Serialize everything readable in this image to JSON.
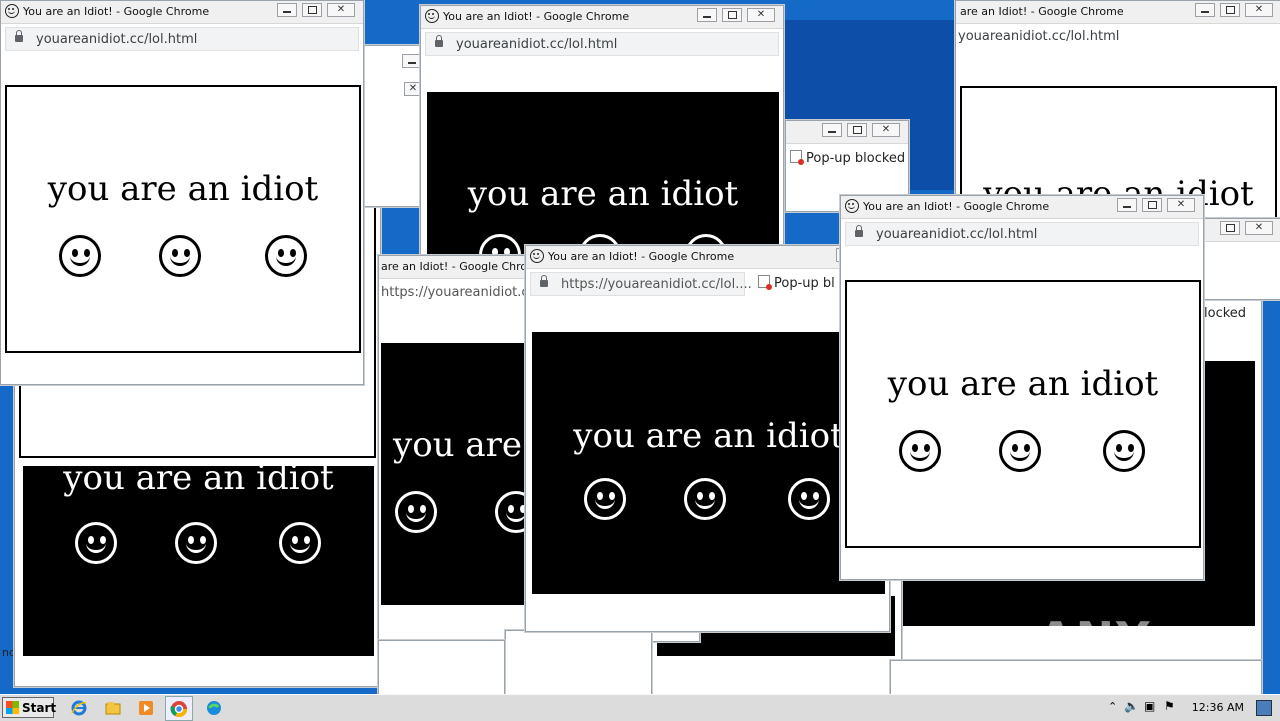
{
  "popup": {
    "title": "You are an Idiot! - Google Chrome",
    "title_partial": "are an Idiot! - Google Chrome",
    "url_short": "youareanidiot.cc/lol.html",
    "url_https": "https://youareanidiot.cc/lol.html",
    "url_https_trunc": "https://youareanidiot.cc/lol....",
    "message": "you are an idiot",
    "message_partial": "you are",
    "popup_blocked": "Pop-up blocked",
    "popup_blocked_trunc": "Pop-up bl",
    "popup_blocked_end": "locked"
  },
  "taskbar": {
    "start": "Start",
    "clock": "12:36 AM",
    "icons": [
      "ie-icon",
      "explorer-icon",
      "media-player-icon",
      "chrome-icon",
      "edge-icon"
    ]
  },
  "desktop": {
    "watermark": "ANY RUN",
    "side_fragment": "no"
  },
  "colors": {
    "desktop": "#1569c7",
    "chrome_frame": "#f0f0f0",
    "address_bar": "#f1f3f4"
  }
}
